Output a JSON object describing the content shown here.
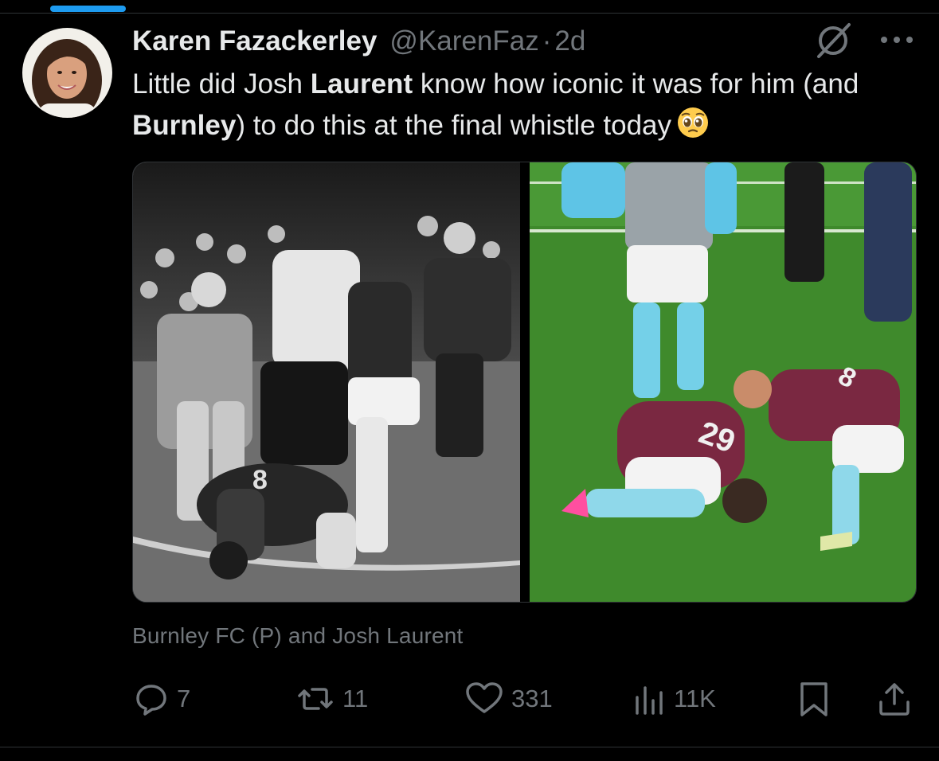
{
  "tweet": {
    "author_name": "Karen Fazackerley",
    "handle": "@KarenFaz",
    "separator": "·",
    "time": "2d",
    "text_parts": {
      "p1": "Little did Josh ",
      "b1": "Laurent",
      "p2": " know how iconic it was for him (and ",
      "b2": "Burnley",
      "p3": ") to do this at the final whistle today"
    },
    "emoji": "pleading-face-emoji",
    "caption": "Burnley FC (P) and Josh Laurent"
  },
  "actions": {
    "replies": "7",
    "reposts": "11",
    "likes": "331",
    "views": "11K"
  },
  "icons": [
    "grok-icon",
    "more-icon",
    "reply-icon",
    "repost-icon",
    "like-icon",
    "views-icon",
    "bookmark-icon",
    "share-icon"
  ],
  "colors": {
    "background": "#000000",
    "text_primary": "#e7e9ea",
    "text_secondary": "#71767b",
    "accent": "#1d9bf0",
    "divider": "#2f3336"
  }
}
